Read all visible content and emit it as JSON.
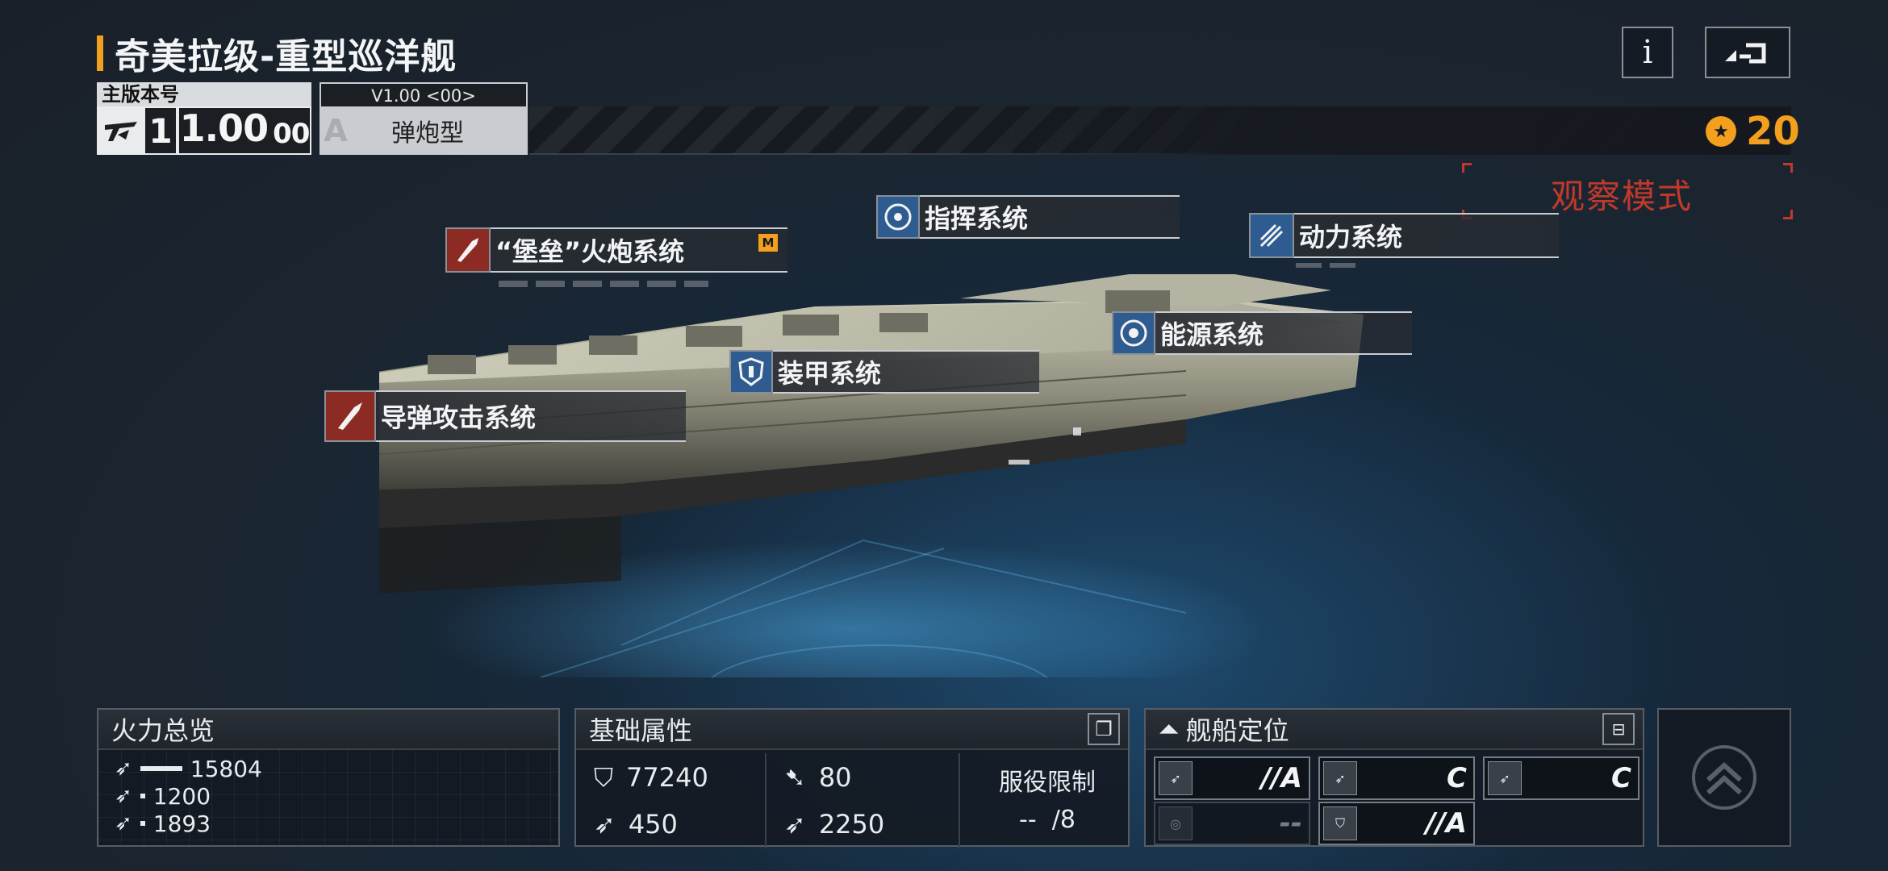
{
  "header": {
    "ship_title": "奇美拉级-重型巡洋舰",
    "info_label": "i"
  },
  "version": {
    "label": "主版本号",
    "tier": "1",
    "number": "1.00",
    "suffix": "00"
  },
  "type": {
    "version_tag": "V1.00 <00>",
    "grade": "A",
    "name": "弹炮型"
  },
  "currency": {
    "value": "20"
  },
  "mode": {
    "label": "观察模式"
  },
  "systems": {
    "cannon": {
      "name": "“堡垒”火炮系统",
      "badge": "M"
    },
    "command": {
      "name": "指挥系统"
    },
    "power": {
      "name": "动力系统"
    },
    "energy": {
      "name": "能源系统"
    },
    "armor": {
      "name": "装甲系统"
    },
    "missile": {
      "name": "导弹攻击系统"
    }
  },
  "firepower": {
    "title": "火力总览",
    "rows": [
      {
        "value": "15804",
        "fill": 1.0
      },
      {
        "value": "1200",
        "fill": 0.076
      },
      {
        "value": "1893",
        "fill": 0.12
      }
    ]
  },
  "base_stats": {
    "title": "基础属性",
    "hp": "77240",
    "speed": "80",
    "armor_pierce": "450",
    "range": "2250",
    "limit_label": "服役限制",
    "limit_value": "--",
    "limit_max": "/8"
  },
  "positioning": {
    "title": "舰船定位",
    "cells": [
      {
        "value": "//A"
      },
      {
        "value": "C"
      },
      {
        "value": "C"
      },
      {
        "value": "--"
      },
      {
        "value": "//A"
      }
    ]
  },
  "colors": {
    "accent": "#f2a01e",
    "alert": "#c0392b",
    "weapon": "#8c2b24",
    "system": "#2f5c90"
  }
}
